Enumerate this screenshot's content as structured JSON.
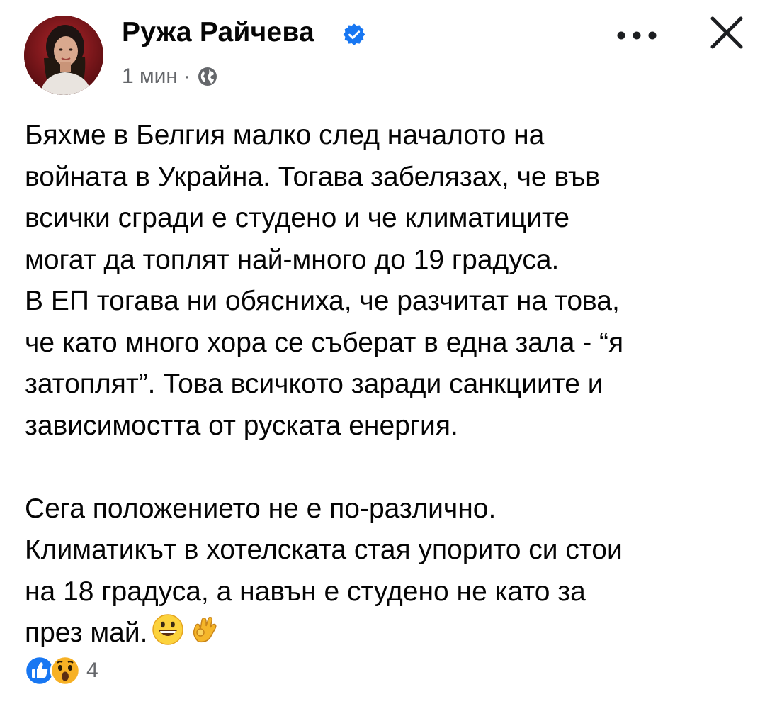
{
  "post": {
    "author": "Ружа Райчева",
    "time": "1 мин",
    "separator": "·",
    "body_lines": [
      "Бяхме в Белгия малко след началото на",
      "войната в Украйна. Тогава забелязах, че във",
      "всички сгради е студено и че климатиците",
      "могат да топлят най-много до 19 градуса.",
      "В ЕП тогава ни обясниха, че разчитат на това,",
      "че като много хора се съберат в една зала - “я",
      "затоплят”. Това всичкото заради санкциите и",
      "зависимостта от руската енергия."
    ],
    "body_lines_2": [
      "Сега положението не е по-различно.",
      "Климатикът в хотелската стая упорито си стои",
      "на 18 градуса, а навън е студено не като за",
      "през май."
    ],
    "reaction_count": "4"
  },
  "icons": {
    "verified": "verified-badge-icon",
    "privacy": "globe-icon",
    "more": "more-options-icon",
    "close": "close-icon",
    "emoji_1": "grinning-face-emoji",
    "emoji_2": "ok-hand-emoji",
    "reaction_1": "like-reaction-icon",
    "reaction_2": "wow-reaction-icon"
  },
  "colors": {
    "text_primary": "#050505",
    "text_secondary": "#65676b",
    "facebook_blue": "#1877f2",
    "reaction_yellow": "#f7b125"
  }
}
